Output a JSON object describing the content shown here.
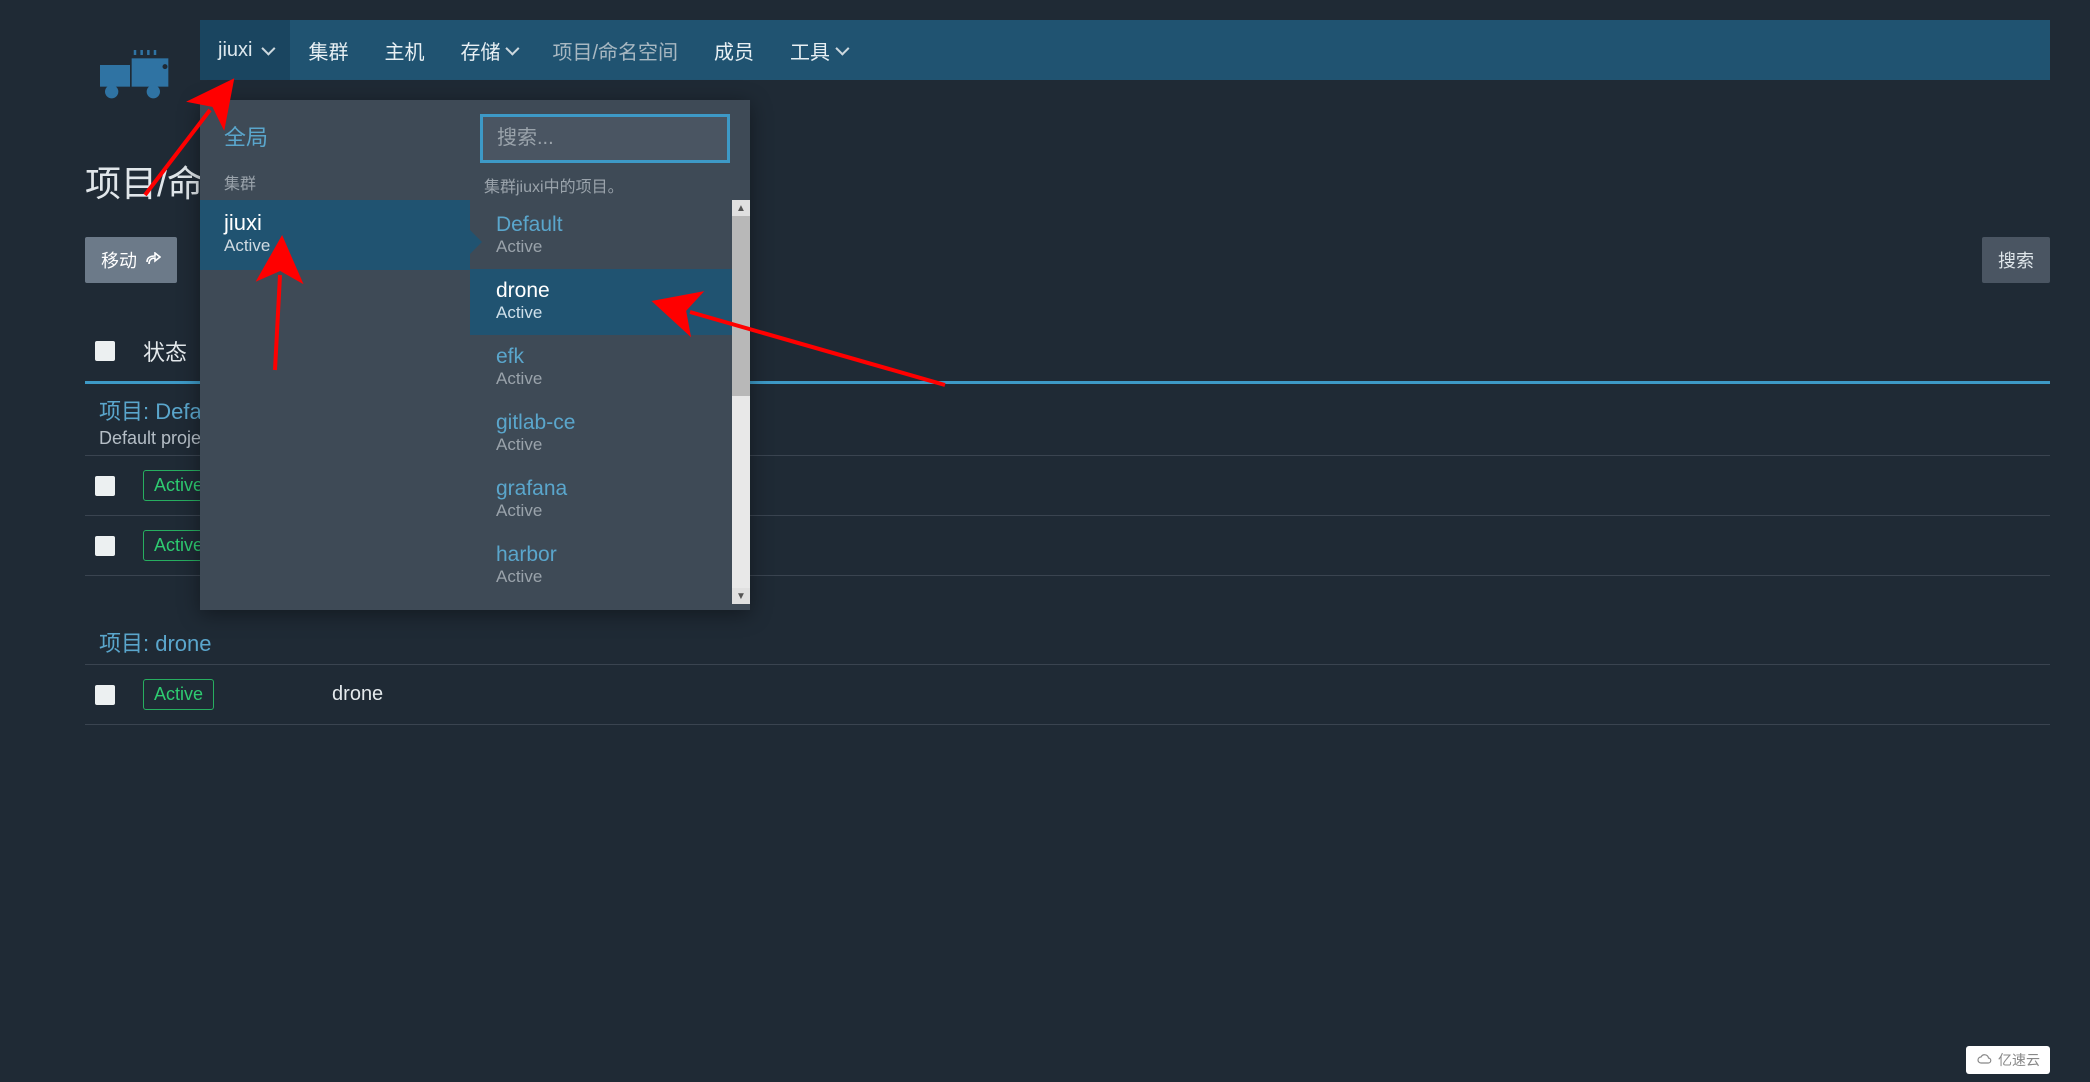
{
  "nav": {
    "cluster_name": "jiuxi",
    "items": [
      {
        "label": "集群",
        "active": false,
        "has_chevron": false
      },
      {
        "label": "主机",
        "active": false,
        "has_chevron": false
      },
      {
        "label": "存储",
        "active": false,
        "has_chevron": true
      },
      {
        "label": "项目/命名空间",
        "active": true,
        "has_chevron": false
      },
      {
        "label": "成员",
        "active": false,
        "has_chevron": false
      },
      {
        "label": "工具",
        "active": false,
        "has_chevron": true
      }
    ]
  },
  "page": {
    "title": "项目/命名",
    "move_button": "移动",
    "search_button": "搜索",
    "status_header": "状态"
  },
  "table": {
    "groups": [
      {
        "title": "项目: Defa",
        "subtitle": "Default proje",
        "rows": [
          {
            "status": "Active"
          },
          {
            "status": "Active"
          }
        ]
      },
      {
        "title": "项目: drone",
        "subtitle": "",
        "rows": [
          {
            "status": "Active",
            "name": "drone"
          }
        ]
      }
    ]
  },
  "flyout": {
    "global_label": "全局",
    "left_section_label": "集群",
    "clusters": [
      {
        "name": "jiuxi",
        "status": "Active",
        "selected": true
      }
    ],
    "search_placeholder": "搜索...",
    "right_hint": "集群jiuxi中的项目。",
    "projects": [
      {
        "name": "Default",
        "status": "Active",
        "highlight": false
      },
      {
        "name": "drone",
        "status": "Active",
        "highlight": true
      },
      {
        "name": "efk",
        "status": "Active",
        "highlight": false
      },
      {
        "name": "gitlab-ce",
        "status": "Active",
        "highlight": false
      },
      {
        "name": "grafana",
        "status": "Active",
        "highlight": false
      },
      {
        "name": "harbor",
        "status": "Active",
        "highlight": false
      }
    ]
  },
  "watermark": "亿速云"
}
